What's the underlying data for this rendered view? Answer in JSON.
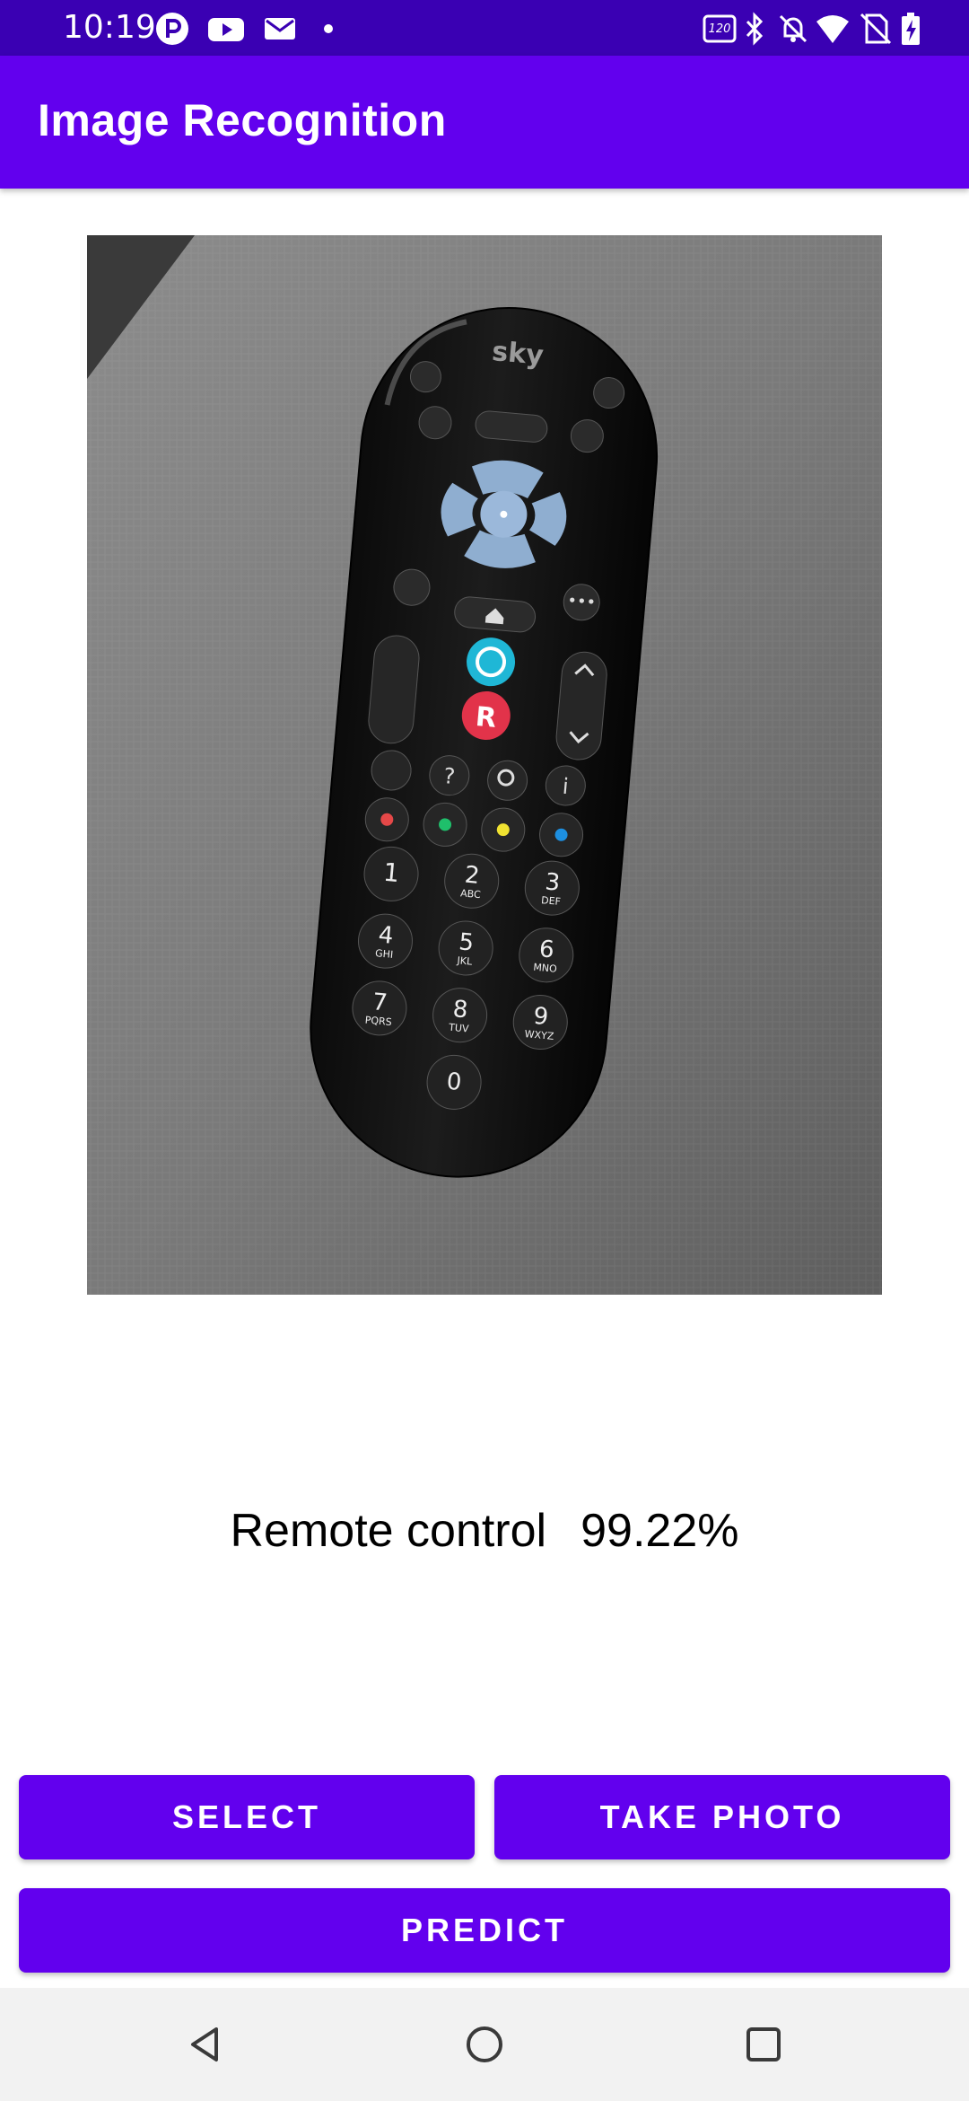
{
  "status_bar": {
    "time": "10:19",
    "left_icons": [
      "p-app-icon",
      "youtube-icon",
      "mail-icon",
      "dot-icon"
    ],
    "right_icons": [
      "refresh-rate-120hz-icon",
      "bluetooth-icon",
      "bell-off-icon",
      "wifi-icon",
      "no-sim-icon",
      "battery-charging-icon"
    ]
  },
  "app_bar": {
    "title": "Image Recognition"
  },
  "image": {
    "subject": "sky",
    "keypad": {
      "k1": "1",
      "k2": "2",
      "k3": "3",
      "k4": "4",
      "k5": "5",
      "k6": "6",
      "k7": "7",
      "k8": "8",
      "k9": "9",
      "k0": "0",
      "s2": "ABC",
      "s3": "DEF",
      "s4": "GHI",
      "s5": "JKL",
      "s6": "MNO",
      "s7": "PQRS",
      "s8": "TUV",
      "s9": "WXYZ",
      "q": "?",
      "info": "i",
      "r": "R"
    }
  },
  "result": {
    "label": "Remote control",
    "confidence": "99.22%"
  },
  "buttons": {
    "select": "SELECT",
    "take_photo": "TAKE PHOTO",
    "predict": "PREDICT"
  },
  "colors": {
    "status_bar": "#3a00b3",
    "primary": "#6200ee",
    "nav_bar": "#f2f2f2"
  },
  "nav": {
    "icons": [
      "back-icon",
      "home-icon",
      "recents-icon"
    ]
  }
}
